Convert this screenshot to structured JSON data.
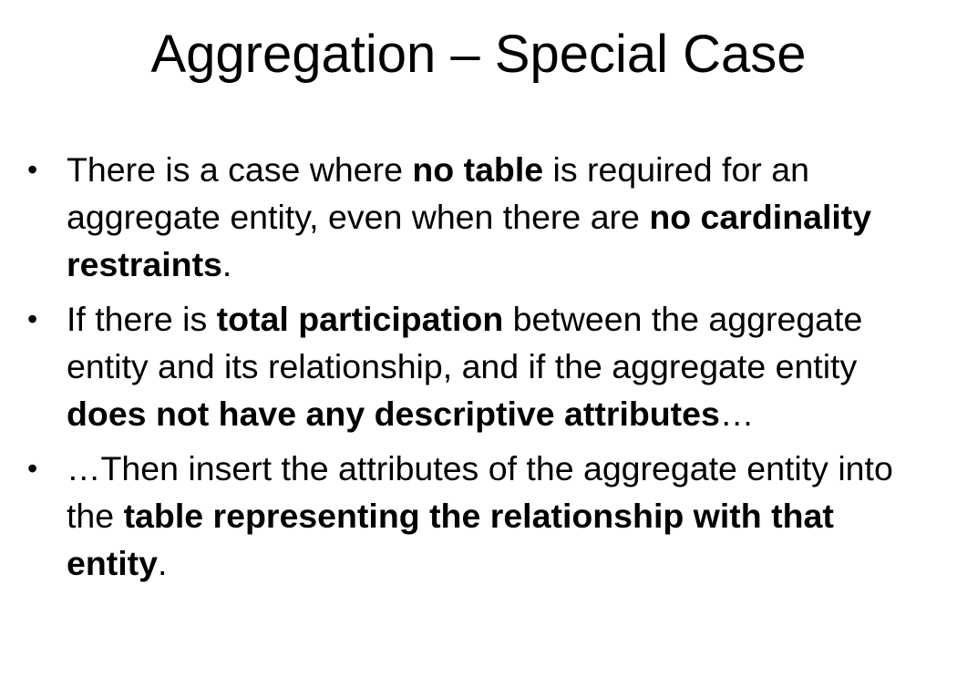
{
  "slide": {
    "title": "Aggregation – Special Case",
    "bullet_glyph": "•",
    "bullets": [
      {
        "segments": [
          {
            "text": "There is a case where ",
            "bold": false
          },
          {
            "text": "no table",
            "bold": true
          },
          {
            "text": " is required for an aggregate entity, even when there are ",
            "bold": false
          },
          {
            "text": "no cardinality restraints",
            "bold": true
          },
          {
            "text": ".",
            "bold": false
          }
        ]
      },
      {
        "segments": [
          {
            "text": "If there is ",
            "bold": false
          },
          {
            "text": "total participation",
            "bold": true
          },
          {
            "text": " between the aggregate entity and its relationship, and if the aggregate entity ",
            "bold": false
          },
          {
            "text": "does not have any descriptive attributes",
            "bold": true
          },
          {
            "text": "…",
            "bold": false
          }
        ]
      },
      {
        "segments": [
          {
            "text": "…Then insert the attributes of the aggregate entity into the ",
            "bold": false
          },
          {
            "text": "table representing the relationship with that entity",
            "bold": true
          },
          {
            "text": ".",
            "bold": false
          }
        ]
      }
    ]
  }
}
